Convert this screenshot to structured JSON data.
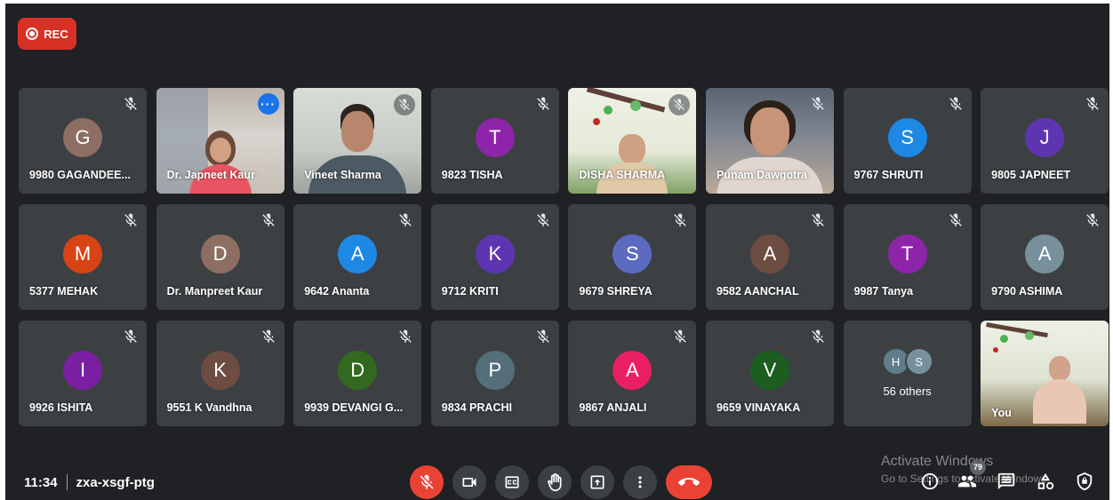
{
  "recording": {
    "label": "REC",
    "color": "#d93025"
  },
  "meeting": {
    "time": "11:34",
    "code": "zxa-xsgf-ptg"
  },
  "participants_count": "79",
  "watermark": {
    "line1": "Activate Windows",
    "line2": "Go to Settings to activate Windows."
  },
  "tiles": [
    {
      "name": "9980 GAGANDEE...",
      "initial": "G",
      "color": "#8d6e63",
      "video": false
    },
    {
      "name": "Dr. Japneet Kaur",
      "video": true,
      "active": true
    },
    {
      "name": "Vineet Sharma",
      "video": true
    },
    {
      "name": "9823 TISHA",
      "initial": "T",
      "color": "#8e24aa",
      "video": false
    },
    {
      "name": "DISHA SHARMA",
      "video": true
    },
    {
      "name": "Punam Dawgotra",
      "video": true
    },
    {
      "name": "9767 SHRUTI",
      "initial": "S",
      "color": "#1e88e5",
      "video": false
    },
    {
      "name": "9805 JAPNEET",
      "initial": "J",
      "color": "#5e35b1",
      "video": false
    },
    {
      "name": "5377 MEHAK",
      "initial": "M",
      "color": "#d84315",
      "video": false
    },
    {
      "name": "Dr. Manpreet Kaur",
      "initial": "D",
      "color": "#8d6e63",
      "video": false
    },
    {
      "name": "9642 Ananta",
      "initial": "A",
      "color": "#1e88e5",
      "video": false
    },
    {
      "name": "9712 KRITI",
      "initial": "K",
      "color": "#5e35b1",
      "video": false
    },
    {
      "name": "9679 SHREYA",
      "initial": "S",
      "color": "#5c6bc0",
      "video": false
    },
    {
      "name": "9582 AANCHAL",
      "initial": "A",
      "color": "#6d4c41",
      "video": false
    },
    {
      "name": "9987 Tanya",
      "initial": "T",
      "color": "#8e24aa",
      "video": false
    },
    {
      "name": "9790 ASHIMA",
      "initial": "A",
      "color": "#78909c",
      "video": false
    },
    {
      "name": "9926 ISHITA",
      "initial": "I",
      "color": "#7b1fa2",
      "video": false
    },
    {
      "name": "9551 K Vandhna",
      "initial": "K",
      "color": "#6d4c41",
      "video": false
    },
    {
      "name": "9939 DEVANGI G...",
      "initial": "D",
      "color": "#33691e",
      "video": false
    },
    {
      "name": "9834 PRACHI",
      "initial": "P",
      "color": "#546e7a",
      "video": false
    },
    {
      "name": "9867 ANJALI",
      "initial": "A",
      "color": "#e91e63",
      "video": false
    },
    {
      "name": "9659 VINAYAKA",
      "initial": "V",
      "color": "#1b5e20",
      "video": false
    }
  ],
  "others": {
    "label": "56 others",
    "initials": [
      "H",
      "S"
    ],
    "colors": [
      "#607d8b",
      "#78909c"
    ]
  },
  "self": {
    "name": "You"
  },
  "icons": {
    "mic_off": "mic-off-icon",
    "camera": "camera-icon",
    "captions": "captions-icon",
    "hand": "raise-hand-icon",
    "present": "present-icon",
    "more": "more-vert-icon",
    "hangup": "hang-up-icon",
    "info": "info-icon",
    "people": "people-icon",
    "chat": "chat-icon",
    "activities": "activities-icon",
    "lock": "host-controls-icon"
  }
}
